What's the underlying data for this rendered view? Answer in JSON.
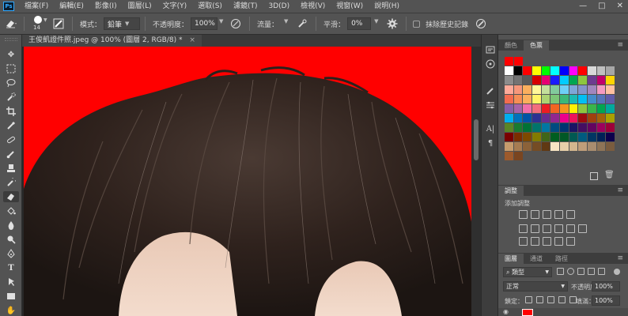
{
  "menubar": {
    "logo": "Ps",
    "items": [
      "檔案(F)",
      "編輯(E)",
      "影像(I)",
      "圖層(L)",
      "文字(Y)",
      "選取(S)",
      "濾鏡(T)",
      "3D(D)",
      "檢視(V)",
      "視窗(W)",
      "說明(H)"
    ],
    "window_controls": [
      "—",
      "□",
      "✕"
    ]
  },
  "options": {
    "brush_size": "14",
    "mode_label": "模式：",
    "mode_value": "鉛筆",
    "opacity_label": "不透明度：",
    "opacity_value": "100%",
    "flow_label": "流量：",
    "smoothing_label": "平滑：",
    "smoothing_value": "0%",
    "history_label": "抹除歷史記錄"
  },
  "document": {
    "tab_title": "王俊凱證件照.jpeg @ 100% (圖層 2, RGB/8) *",
    "close": "×"
  },
  "panels": {
    "swatches": {
      "tabs": [
        "顏色",
        "色票"
      ],
      "active_tab": 1,
      "rows": [
        [
          "#ff0000",
          "#ff0000"
        ],
        [
          "#ffffff",
          "#000000",
          "#ff0000",
          "#ffff00",
          "#00ff00",
          "#00ffff",
          "#0000ff",
          "#ff00ff",
          "#ff0000",
          "#d9d9d9",
          "#bfbfbf",
          "#a6a6a6"
        ],
        [
          "#8c8c8c",
          "#737373",
          "#595959",
          "#d60000",
          "#e60073",
          "#1a1aff",
          "#00ccff",
          "#00a651",
          "#8dc63f",
          "#6d3b8f",
          "#c3006b",
          "#ffd400"
        ],
        [
          "#ffaa99",
          "#f7977a",
          "#fbaf5d",
          "#fff799",
          "#c4df9b",
          "#82ca9c",
          "#6dcff6",
          "#7ea7d8",
          "#8493ca",
          "#a186be",
          "#f49ac1",
          "#ffc0a0"
        ],
        [
          "#f26c4f",
          "#f68e55",
          "#fbaf5c",
          "#fff467",
          "#acd372",
          "#7cc576",
          "#3bb878",
          "#1abbb4",
          "#00bff3",
          "#438cca",
          "#5574b9",
          "#605ca8"
        ],
        [
          "#855fa8",
          "#a763a8",
          "#f06eaa",
          "#f26d7d",
          "#ed1c24",
          "#f26522",
          "#f7941d",
          "#fff200",
          "#8dc63f",
          "#39b54a",
          "#00a651",
          "#00a99d"
        ],
        [
          "#00aeef",
          "#0072bc",
          "#0054a6",
          "#2e3192",
          "#662d91",
          "#92278f",
          "#ec008c",
          "#ed145b",
          "#9e0b0f",
          "#a0410d",
          "#a3620a",
          "#aba000"
        ],
        [
          "#598527",
          "#197b30",
          "#007236",
          "#00746b",
          "#0076a3",
          "#004b80",
          "#003471",
          "#1b1464",
          "#440e62",
          "#630460",
          "#9e005d",
          "#9e0039"
        ],
        [
          "#790000",
          "#7b2e00",
          "#7d4900",
          "#827b00",
          "#406618",
          "#005e20",
          "#005826",
          "#005952",
          "#005b7f",
          "#003663",
          "#002157",
          "#0d004c"
        ],
        [
          "#c69c6d",
          "#a67c52",
          "#8c6239",
          "#754c24",
          "#603913",
          "#f7e4c3",
          "#e8d0a9",
          "#d3b68e",
          "#bf9e7a",
          "#a98d6f",
          "#8e7457",
          "#7a5c3f"
        ],
        [
          "#9c5a2c",
          "#7a4520"
        ]
      ]
    },
    "adjustments": {
      "tab": "調整",
      "add_label": "添加調整"
    },
    "layers": {
      "tabs": [
        "圖層",
        "通道",
        "路徑"
      ],
      "active_tab": 0,
      "kind_label": "類型",
      "blend_mode": "正常",
      "opacity_label": "不透明度：",
      "opacity_value": "100%",
      "lock_label": "鎖定：",
      "fill_label": "填滿：",
      "fill_value": "100%"
    }
  }
}
